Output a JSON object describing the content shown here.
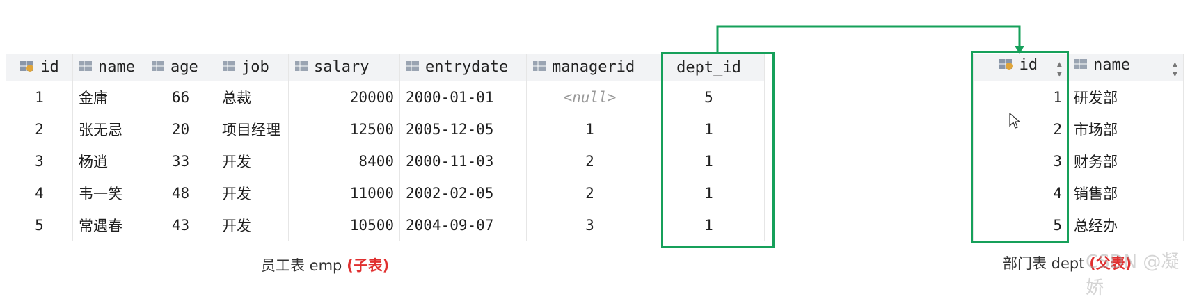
{
  "emp": {
    "caption_name": "员工表 emp",
    "caption_tag": "(子表)",
    "columns": [
      "id",
      "name",
      "age",
      "job",
      "salary",
      "entrydate",
      "managerid",
      "dept_id"
    ],
    "rows": [
      [
        "1",
        "金庸",
        "66",
        "总裁",
        "20000",
        "2000-01-01",
        "<null>",
        "5"
      ],
      [
        "2",
        "张无忌",
        "20",
        "项目经理",
        "12500",
        "2005-12-05",
        "1",
        "1"
      ],
      [
        "3",
        "杨逍",
        "33",
        "开发",
        "8400",
        "2000-11-03",
        "2",
        "1"
      ],
      [
        "4",
        "韦一笑",
        "48",
        "开发",
        "11000",
        "2002-02-05",
        "2",
        "1"
      ],
      [
        "5",
        "常遇春",
        "43",
        "开发",
        "10500",
        "2004-09-07",
        "3",
        "1"
      ]
    ]
  },
  "dept": {
    "caption_name": "部门表 dept",
    "caption_tag": "(父表)",
    "columns": [
      "id",
      "name"
    ],
    "rows": [
      [
        "1",
        "研发部"
      ],
      [
        "2",
        "市场部"
      ],
      [
        "3",
        "财务部"
      ],
      [
        "4",
        "销售部"
      ],
      [
        "5",
        "总经办"
      ]
    ]
  },
  "watermark": "CSDN @凝娇",
  "colors": {
    "highlight": "#16a05a",
    "tag": "#e03030",
    "key_icon": "#e0a53a"
  }
}
